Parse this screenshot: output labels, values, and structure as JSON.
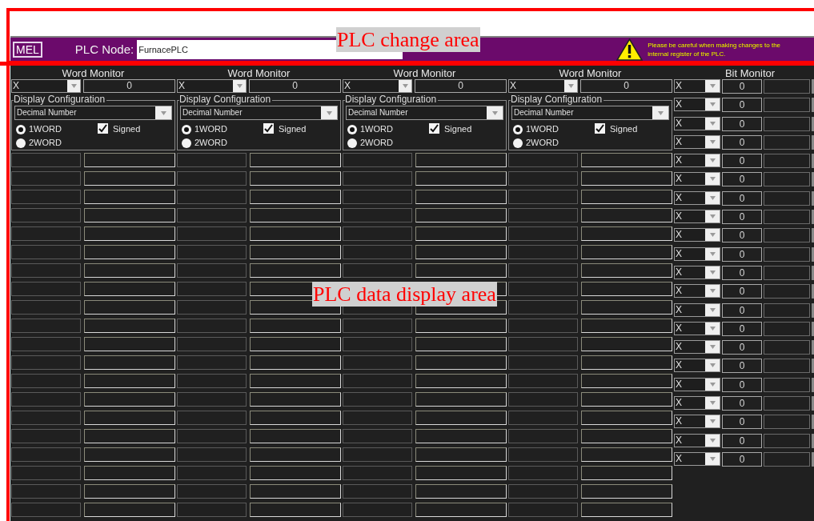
{
  "annotations": [
    {
      "label": "PLC change area",
      "kind": "change"
    },
    {
      "label": "PLC data display area",
      "kind": "display"
    }
  ],
  "header": {
    "logo": "MEL",
    "plc_node_label": "PLC Node:",
    "plc_node_value": "FurnacePLC",
    "warning": "Please be careful when making changes to the internal register of the PLC."
  },
  "word_monitors": [
    {
      "title": "Word Monitor",
      "device": "X",
      "value": "0",
      "config_title": "Display Configuration",
      "format": "Decimal Number",
      "options": [
        {
          "label": "1WORD",
          "selected": true
        },
        {
          "label": "2WORD",
          "selected": false
        }
      ],
      "signed": {
        "label": "Signed",
        "checked": true
      }
    },
    {
      "title": "Word Monitor",
      "device": "X",
      "value": "0",
      "config_title": "Display Configuration",
      "format": "Decimal Number",
      "options": [
        {
          "label": "1WORD",
          "selected": true
        },
        {
          "label": "2WORD",
          "selected": false
        }
      ],
      "signed": {
        "label": "Signed",
        "checked": true
      }
    },
    {
      "title": "Word Monitor",
      "device": "X",
      "value": "0",
      "config_title": "Display Configuration",
      "format": "Decimal Number",
      "options": [
        {
          "label": "1WORD",
          "selected": true
        },
        {
          "label": "2WORD",
          "selected": false
        }
      ],
      "signed": {
        "label": "Signed",
        "checked": true
      }
    },
    {
      "title": "Word Monitor",
      "device": "X",
      "value": "0",
      "config_title": "Display Configuration",
      "format": "Decimal Number",
      "options": [
        {
          "label": "1WORD",
          "selected": true
        },
        {
          "label": "2WORD",
          "selected": false
        }
      ],
      "signed": {
        "label": "Signed",
        "checked": true
      }
    }
  ],
  "bit_monitor": {
    "title": "Bit Monitor",
    "rows": [
      {
        "device": "X",
        "value": "0"
      },
      {
        "device": "X",
        "value": "0"
      },
      {
        "device": "X",
        "value": "0"
      },
      {
        "device": "X",
        "value": "0"
      },
      {
        "device": "X",
        "value": "0"
      },
      {
        "device": "X",
        "value": "0"
      },
      {
        "device": "X",
        "value": "0"
      },
      {
        "device": "X",
        "value": "0"
      },
      {
        "device": "X",
        "value": "0"
      },
      {
        "device": "X",
        "value": "0"
      },
      {
        "device": "X",
        "value": "0"
      },
      {
        "device": "X",
        "value": "0"
      },
      {
        "device": "X",
        "value": "0"
      },
      {
        "device": "X",
        "value": "0"
      },
      {
        "device": "X",
        "value": "0"
      },
      {
        "device": "X",
        "value": "0"
      },
      {
        "device": "X",
        "value": "0"
      },
      {
        "device": "X",
        "value": "0"
      },
      {
        "device": "X",
        "value": "0"
      },
      {
        "device": "X",
        "value": "0"
      },
      {
        "device": "X",
        "value": "0"
      }
    ]
  }
}
